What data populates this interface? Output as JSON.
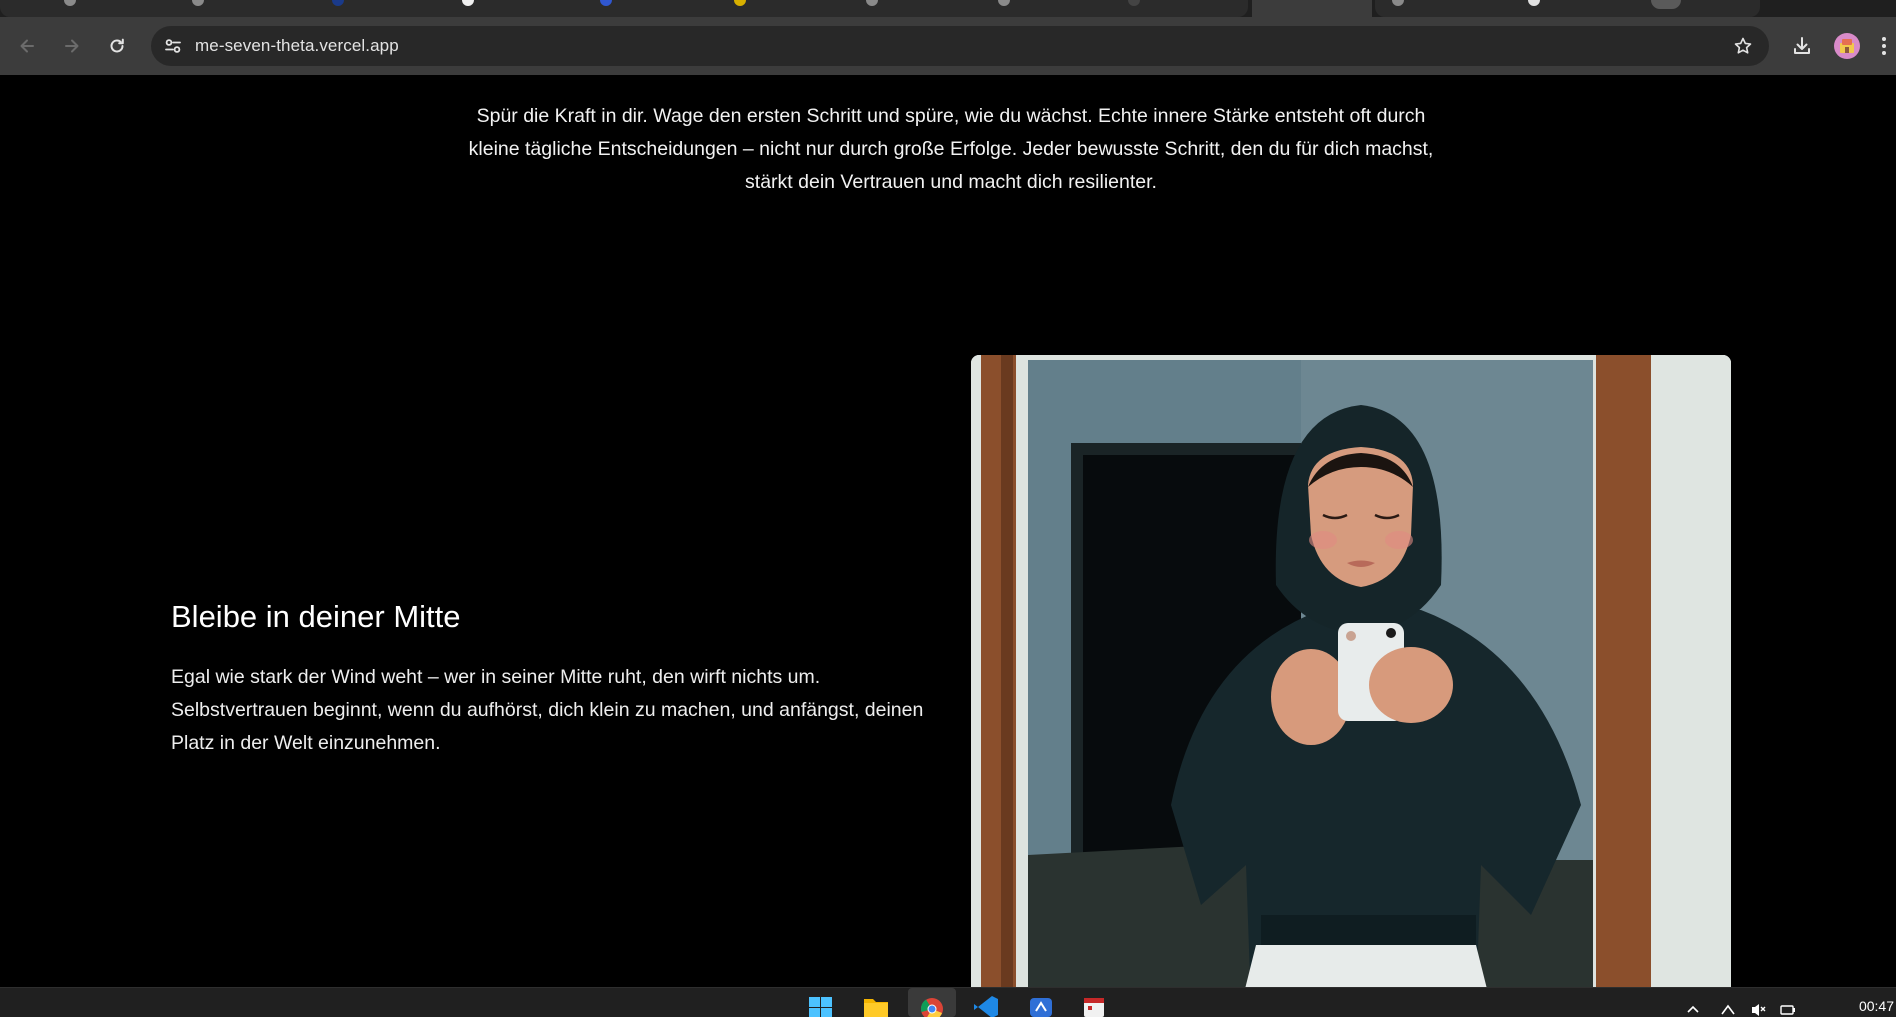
{
  "browser": {
    "url": "me-seven-theta.vercel.app",
    "icons": [
      "back-icon",
      "forward-icon",
      "reload-icon",
      "site-info-icon",
      "bookmark-star-icon",
      "download-icon",
      "profile-avatar",
      "menu-icon"
    ]
  },
  "page": {
    "intro": "Spür die Kraft in dir. Wage den ersten Schritt und spüre, wie du wächst. Echte innere Stärke entsteht oft durch kleine tägliche Entscheidungen – nicht nur durch große Erfolge. Jeder bewusste Schritt, den du für dich machst, stärkt dein Vertrauen und macht dich resilienter.",
    "section_title": "Bleibe in deiner Mitte",
    "section_body": "Egal wie stark der Wind weht – wer in seiner Mitte ruht, den wirft nichts um. Selbstvertrauen beginnt, wenn du aufhörst, dich klein zu machen, und anfängst, deinen Platz in der Welt einzunehmen.",
    "hero_image": "illustration-hooded-person-phone-mirror-selfie"
  },
  "taskbar": {
    "clock": "00:47",
    "apps": [
      "windows-start-icon",
      "file-explorer-icon",
      "chrome-icon",
      "vscode-icon",
      "app-icon",
      "calendar-app-icon"
    ]
  },
  "colors": {
    "page_background": "#000000",
    "toolbar": "#3c3c3c",
    "omnibox": "#282828",
    "text": "#ffffff"
  }
}
